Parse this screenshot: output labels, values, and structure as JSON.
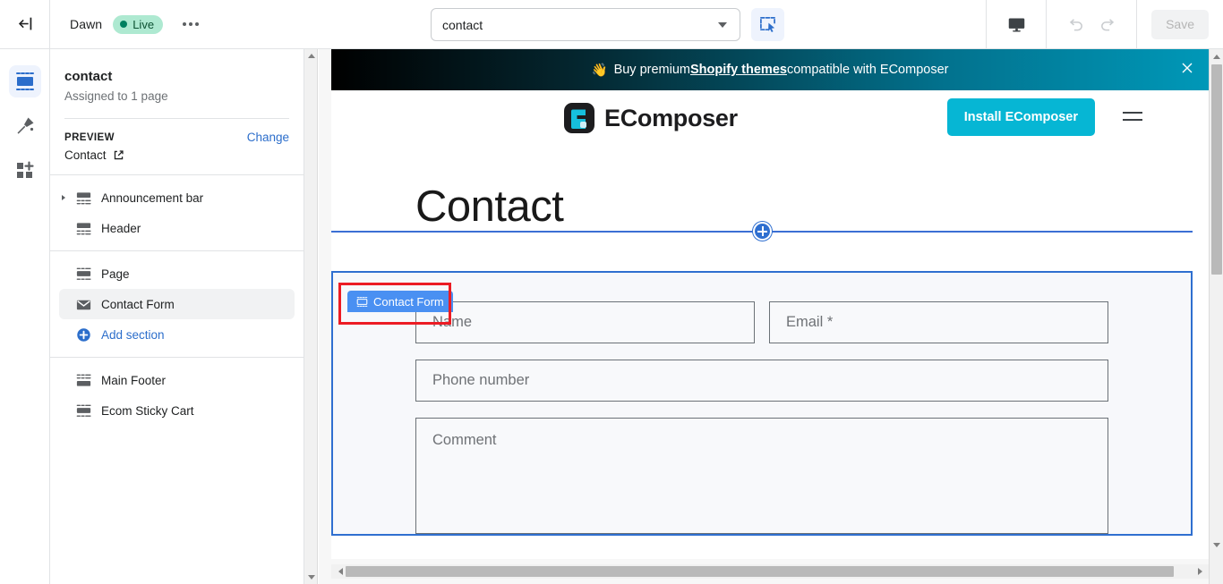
{
  "topbar": {
    "exit_icon": "exit-arrow-icon",
    "theme_name": "Dawn",
    "live_badge": "Live",
    "more_icon": "more-horizontal-icon",
    "page_selector_value": "contact",
    "page_selector_caret": "chevron-down-icon",
    "inspect_icon": "select-element-icon",
    "device_icon": "desktop-icon",
    "undo_icon": "undo-icon",
    "redo_icon": "redo-icon",
    "save_label": "Save",
    "save_disabled": true
  },
  "rail": {
    "items": [
      {
        "name": "sections-icon",
        "label": "Sections",
        "active": true
      },
      {
        "name": "theme-settings-icon",
        "label": "Theme settings",
        "active": false
      },
      {
        "name": "apps-icon",
        "label": "Apps",
        "active": false
      }
    ]
  },
  "sidebar": {
    "title": "contact",
    "subtitle": "Assigned to 1 page",
    "preview_label": "PREVIEW",
    "change_label": "Change",
    "preview_value": "Contact",
    "preview_external_icon": "external-link-icon",
    "groups": [
      {
        "items": [
          {
            "label": "Announcement bar",
            "icon": "section-top-icon",
            "disclosure": true,
            "selected": false
          },
          {
            "label": "Header",
            "icon": "section-header-icon",
            "disclosure": false,
            "selected": false
          }
        ]
      },
      {
        "items": [
          {
            "label": "Page",
            "icon": "section-page-icon",
            "disclosure": false,
            "selected": false
          },
          {
            "label": "Contact Form",
            "icon": "envelope-icon",
            "disclosure": false,
            "selected": true
          },
          {
            "label": "Add section",
            "icon": "plus-circle-icon",
            "disclosure": false,
            "selected": false,
            "is_add": true
          }
        ]
      },
      {
        "items": [
          {
            "label": "Main Footer",
            "icon": "section-footer-icon",
            "disclosure": false,
            "selected": false
          },
          {
            "label": "Ecom Sticky Cart",
            "icon": "section-bottom-icon",
            "disclosure": false,
            "selected": false
          }
        ]
      }
    ]
  },
  "preview": {
    "announcement": {
      "emoji": "👋",
      "text_before": "Buy premium ",
      "link_text": "Shopify themes",
      "text_after": " compatible with EComposer",
      "close_icon": "close-icon"
    },
    "header": {
      "logo_icon": "ecomposer-logo-icon",
      "brand": "EComposer",
      "install_label": "Install EComposer",
      "menu_icon": "hamburger-menu-icon"
    },
    "page_title": "Contact",
    "add_section_icon": "plus-circle-icon",
    "section_badge": {
      "icon": "section-icon",
      "label": "Contact Form"
    },
    "form": {
      "name_placeholder": "Name",
      "email_placeholder": "Email *",
      "phone_placeholder": "Phone number",
      "comment_placeholder": "Comment"
    }
  },
  "colors": {
    "accent_blue": "#2c6ecb",
    "selection_blue": "#2f6fd0",
    "badge_blue": "#4a90f2",
    "annotation_red": "#ec1c24",
    "brand_cyan": "#06b6d4",
    "live_green": "#008060"
  },
  "scrollbars": {
    "sidebar_up": "scroll-up-arrow",
    "sidebar_down": "scroll-down-arrow",
    "canvas_up": "scroll-up-arrow",
    "canvas_down": "scroll-down-arrow",
    "canvas_left": "scroll-left-arrow",
    "canvas_right": "scroll-right-arrow"
  }
}
